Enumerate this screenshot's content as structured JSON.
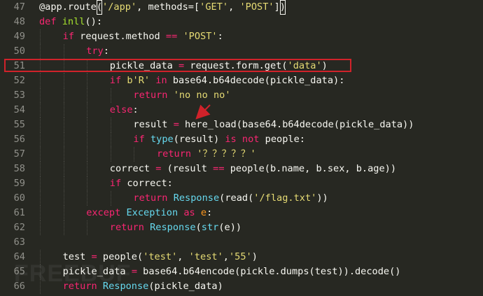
{
  "editor": {
    "lines": [
      {
        "n": "47",
        "indent": 0,
        "tokens": [
          [
            "txt",
            "@app.route"
          ],
          [
            "bracket",
            "("
          ],
          [
            "str",
            "'/app'"
          ],
          [
            "txt",
            ", methods=["
          ],
          [
            "str",
            "'GET'"
          ],
          [
            "txt",
            ", "
          ],
          [
            "str",
            "'POST'"
          ],
          [
            "txt",
            "]"
          ],
          [
            "bracket",
            ")"
          ]
        ]
      },
      {
        "n": "48",
        "indent": 0,
        "tokens": [
          [
            "kw",
            "def "
          ],
          [
            "fn",
            "inll"
          ],
          [
            "txt",
            "():"
          ]
        ]
      },
      {
        "n": "49",
        "indent": 1,
        "tokens": [
          [
            "kw",
            "if "
          ],
          [
            "txt",
            "request.method "
          ],
          [
            "kw",
            "=="
          ],
          [
            "txt",
            " "
          ],
          [
            "str",
            "'POST'"
          ],
          [
            "txt",
            ":"
          ]
        ]
      },
      {
        "n": "50",
        "indent": 2,
        "tokens": [
          [
            "kw",
            "try"
          ],
          [
            "txt",
            ":"
          ]
        ]
      },
      {
        "n": "51",
        "indent": 3,
        "tokens": [
          [
            "txt",
            "pickle_data "
          ],
          [
            "kw",
            "="
          ],
          [
            "txt",
            " request.form.get("
          ],
          [
            "str",
            "'data'"
          ],
          [
            "txt",
            ")"
          ]
        ]
      },
      {
        "n": "52",
        "indent": 3,
        "tokens": [
          [
            "kw",
            "if "
          ],
          [
            "str",
            "b'R'"
          ],
          [
            "txt",
            " "
          ],
          [
            "kw",
            "in"
          ],
          [
            "txt",
            " base64.b64decode(pickle_data):"
          ]
        ]
      },
      {
        "n": "53",
        "indent": 4,
        "tokens": [
          [
            "kw",
            "return "
          ],
          [
            "str",
            "'no no no'"
          ]
        ]
      },
      {
        "n": "54",
        "indent": 3,
        "tokens": [
          [
            "kw",
            "else"
          ],
          [
            "txt",
            ":"
          ]
        ]
      },
      {
        "n": "55",
        "indent": 4,
        "tokens": [
          [
            "txt",
            "result "
          ],
          [
            "kw",
            "="
          ],
          [
            "txt",
            " here_load(base64.b64decode(pickle_data))"
          ]
        ]
      },
      {
        "n": "56",
        "indent": 4,
        "tokens": [
          [
            "kw",
            "if "
          ],
          [
            "cls",
            "type"
          ],
          [
            "txt",
            "(result) "
          ],
          [
            "kw",
            "is not"
          ],
          [
            "txt",
            " people:"
          ]
        ]
      },
      {
        "n": "57",
        "indent": 5,
        "tokens": [
          [
            "kw",
            "return "
          ],
          [
            "str",
            "'？？？？？'"
          ]
        ]
      },
      {
        "n": "58",
        "indent": 3,
        "tokens": [
          [
            "txt",
            "correct "
          ],
          [
            "kw",
            "="
          ],
          [
            "txt",
            " (result "
          ],
          [
            "kw",
            "=="
          ],
          [
            "txt",
            " people(b.name, b.sex, b.age))"
          ]
        ]
      },
      {
        "n": "59",
        "indent": 3,
        "tokens": [
          [
            "kw",
            "if "
          ],
          [
            "txt",
            "correct:"
          ]
        ]
      },
      {
        "n": "60",
        "indent": 4,
        "tokens": [
          [
            "kw",
            "return "
          ],
          [
            "cls",
            "Response"
          ],
          [
            "txt",
            "(read("
          ],
          [
            "str",
            "'/flag.txt'"
          ],
          [
            "txt",
            "))"
          ]
        ]
      },
      {
        "n": "61",
        "indent": 2,
        "tokens": [
          [
            "kw",
            "except "
          ],
          [
            "cls",
            "Exception"
          ],
          [
            "txt",
            " "
          ],
          [
            "kw",
            "as"
          ],
          [
            "txt",
            " "
          ],
          [
            "var",
            "e"
          ],
          [
            "txt",
            ":"
          ]
        ]
      },
      {
        "n": "62",
        "indent": 3,
        "tokens": [
          [
            "kw",
            "return "
          ],
          [
            "cls",
            "Response"
          ],
          [
            "txt",
            "("
          ],
          [
            "cls",
            "str"
          ],
          [
            "txt",
            "(e))"
          ]
        ]
      },
      {
        "n": "63",
        "indent": 0,
        "tokens": []
      },
      {
        "n": "64",
        "indent": 1,
        "tokens": [
          [
            "txt",
            "test "
          ],
          [
            "kw",
            "="
          ],
          [
            "txt",
            " people("
          ],
          [
            "str",
            "'test'"
          ],
          [
            "txt",
            ", "
          ],
          [
            "str",
            "'test'"
          ],
          [
            "txt",
            ","
          ],
          [
            "str",
            "'55'"
          ],
          [
            "txt",
            ")"
          ]
        ]
      },
      {
        "n": "65",
        "indent": 1,
        "tokens": [
          [
            "txt",
            "pickle_data "
          ],
          [
            "kw",
            "="
          ],
          [
            "txt",
            " base64.b64encode(pickle.dumps(test)).decode()"
          ]
        ]
      },
      {
        "n": "66",
        "indent": 1,
        "tokens": [
          [
            "kw",
            "return "
          ],
          [
            "cls",
            "Response"
          ],
          [
            "txt",
            "(pickle_data)"
          ]
        ]
      }
    ],
    "colors": {
      "background": "#272822",
      "highlight_border": "#d0222a",
      "arrow": "#d0222a"
    }
  },
  "watermark": {
    "text": "FREEBUF"
  }
}
